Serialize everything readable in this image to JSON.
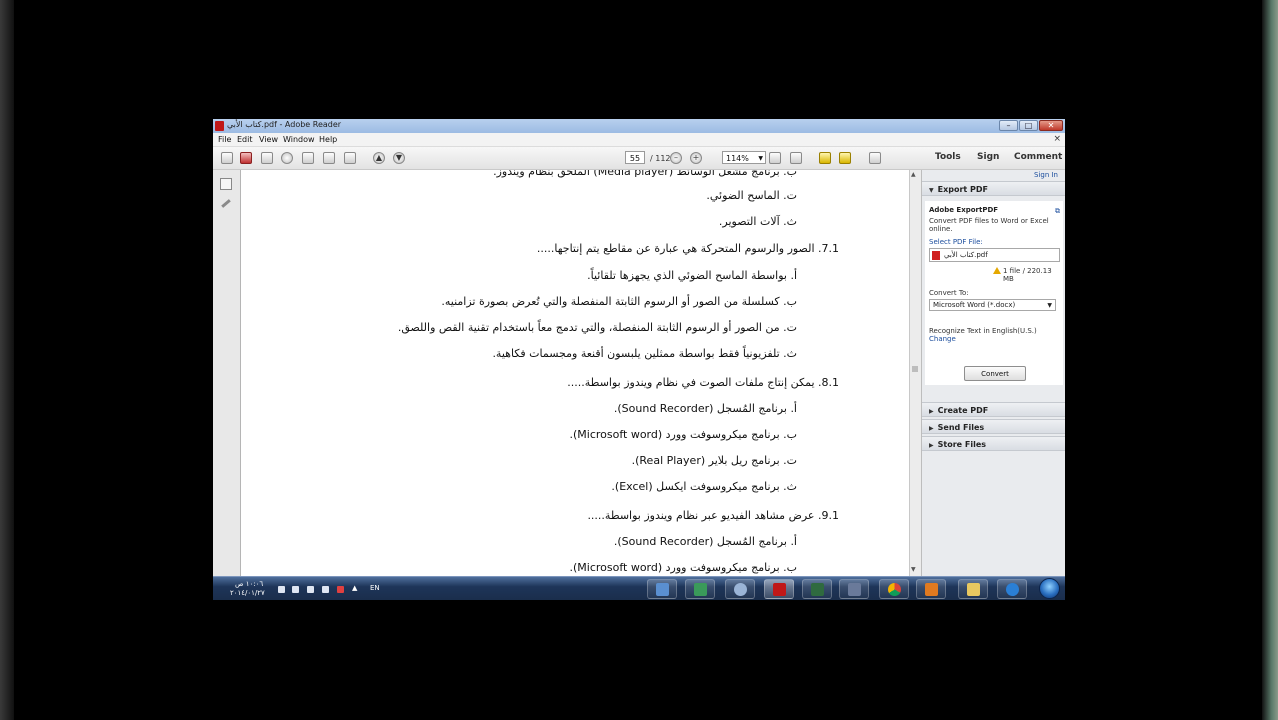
{
  "window": {
    "title": "كتاب الأبي.pdf - Adobe Reader",
    "minimize": "–",
    "maximize": "□",
    "close": "✕",
    "doc_close": "×"
  },
  "menu": [
    "File",
    "Edit",
    "View",
    "Window",
    "Help"
  ],
  "toolbar": {
    "page_current": "55",
    "page_total": "/ 112",
    "zoom": "114%",
    "tools_label": "Tools",
    "sign_label": "Sign",
    "comment_label": "Comment"
  },
  "document": {
    "lines": [
      "ب. برنامج مشغل الوسائط (Media player) الملحق بنظام ويندوز.",
      "ت. الماسح الضوئي.",
      "ث. آلات التصوير.",
      "7.1. الصور والرسوم المتحركة هي عبارة عن مقاطع يتم إنتاجها.....",
      "أ. بواسطة الماسح الضوئي الذي يجهزها تلقائياً.",
      "ب. كسلسلة من الصور أو الرسوم الثابتة المنفصلة والتي تُعرض بصورة تزامنيه.",
      "ت. من الصور أو الرسوم الثابتة المنفصلة، والتي تدمج معاً باستخدام تقنية القص واللصق.",
      "ث. تلفزيونياً فقط بواسطة ممثلين يلبسون أقنعة ومجسمات فكاهية.",
      "8.1. يمكن إنتاج ملفات الصوت في نظام ويندوز بواسطة.....",
      "أ. برنامج المُسجل (Sound Recorder).",
      "ب. برنامج ميكروسوفت وورد (Microsoft word).",
      "ت. برنامج ريل بلاير (Real Player).",
      "ث. برنامج ميكروسوفت ايكسل (Excel).",
      "9.1. عرض مشاهد الفيديو عبر نظام ويندوز بواسطة.....",
      "أ. برنامج المُسجل (Sound Recorder).",
      "ب. برنامج ميكروسوفت وورد (Microsoft word)."
    ]
  },
  "panel": {
    "sign_in": "Sign In",
    "export_header": "Export PDF",
    "service_title": "Adobe ExportPDF",
    "service_desc_1": "Convert PDF files to Word or Excel",
    "service_desc_2": "online.",
    "select_label": "Select PDF File:",
    "file_name": "كتاب الأبي.pdf",
    "file_info": "1 file / 220.13 MB",
    "convert_to_label": "Convert To:",
    "convert_to_value": "Microsoft Word (*.docx)",
    "recognize_text": "Recognize Text in English(U.S.)",
    "change_link": "Change",
    "convert_button": "Convert",
    "create_pdf": "Create PDF",
    "send_files": "Send Files",
    "store_files": "Store Files"
  },
  "taskbar": {
    "time": "١٠:٠٦ ص",
    "date": "٢٠١٤/٠١/٢٧",
    "lang": "EN"
  },
  "colors": {
    "titlebar": "#9cbbe3",
    "taskbar": "#1e3559",
    "link": "#1a4c9c",
    "pdf_red": "#c01818"
  }
}
